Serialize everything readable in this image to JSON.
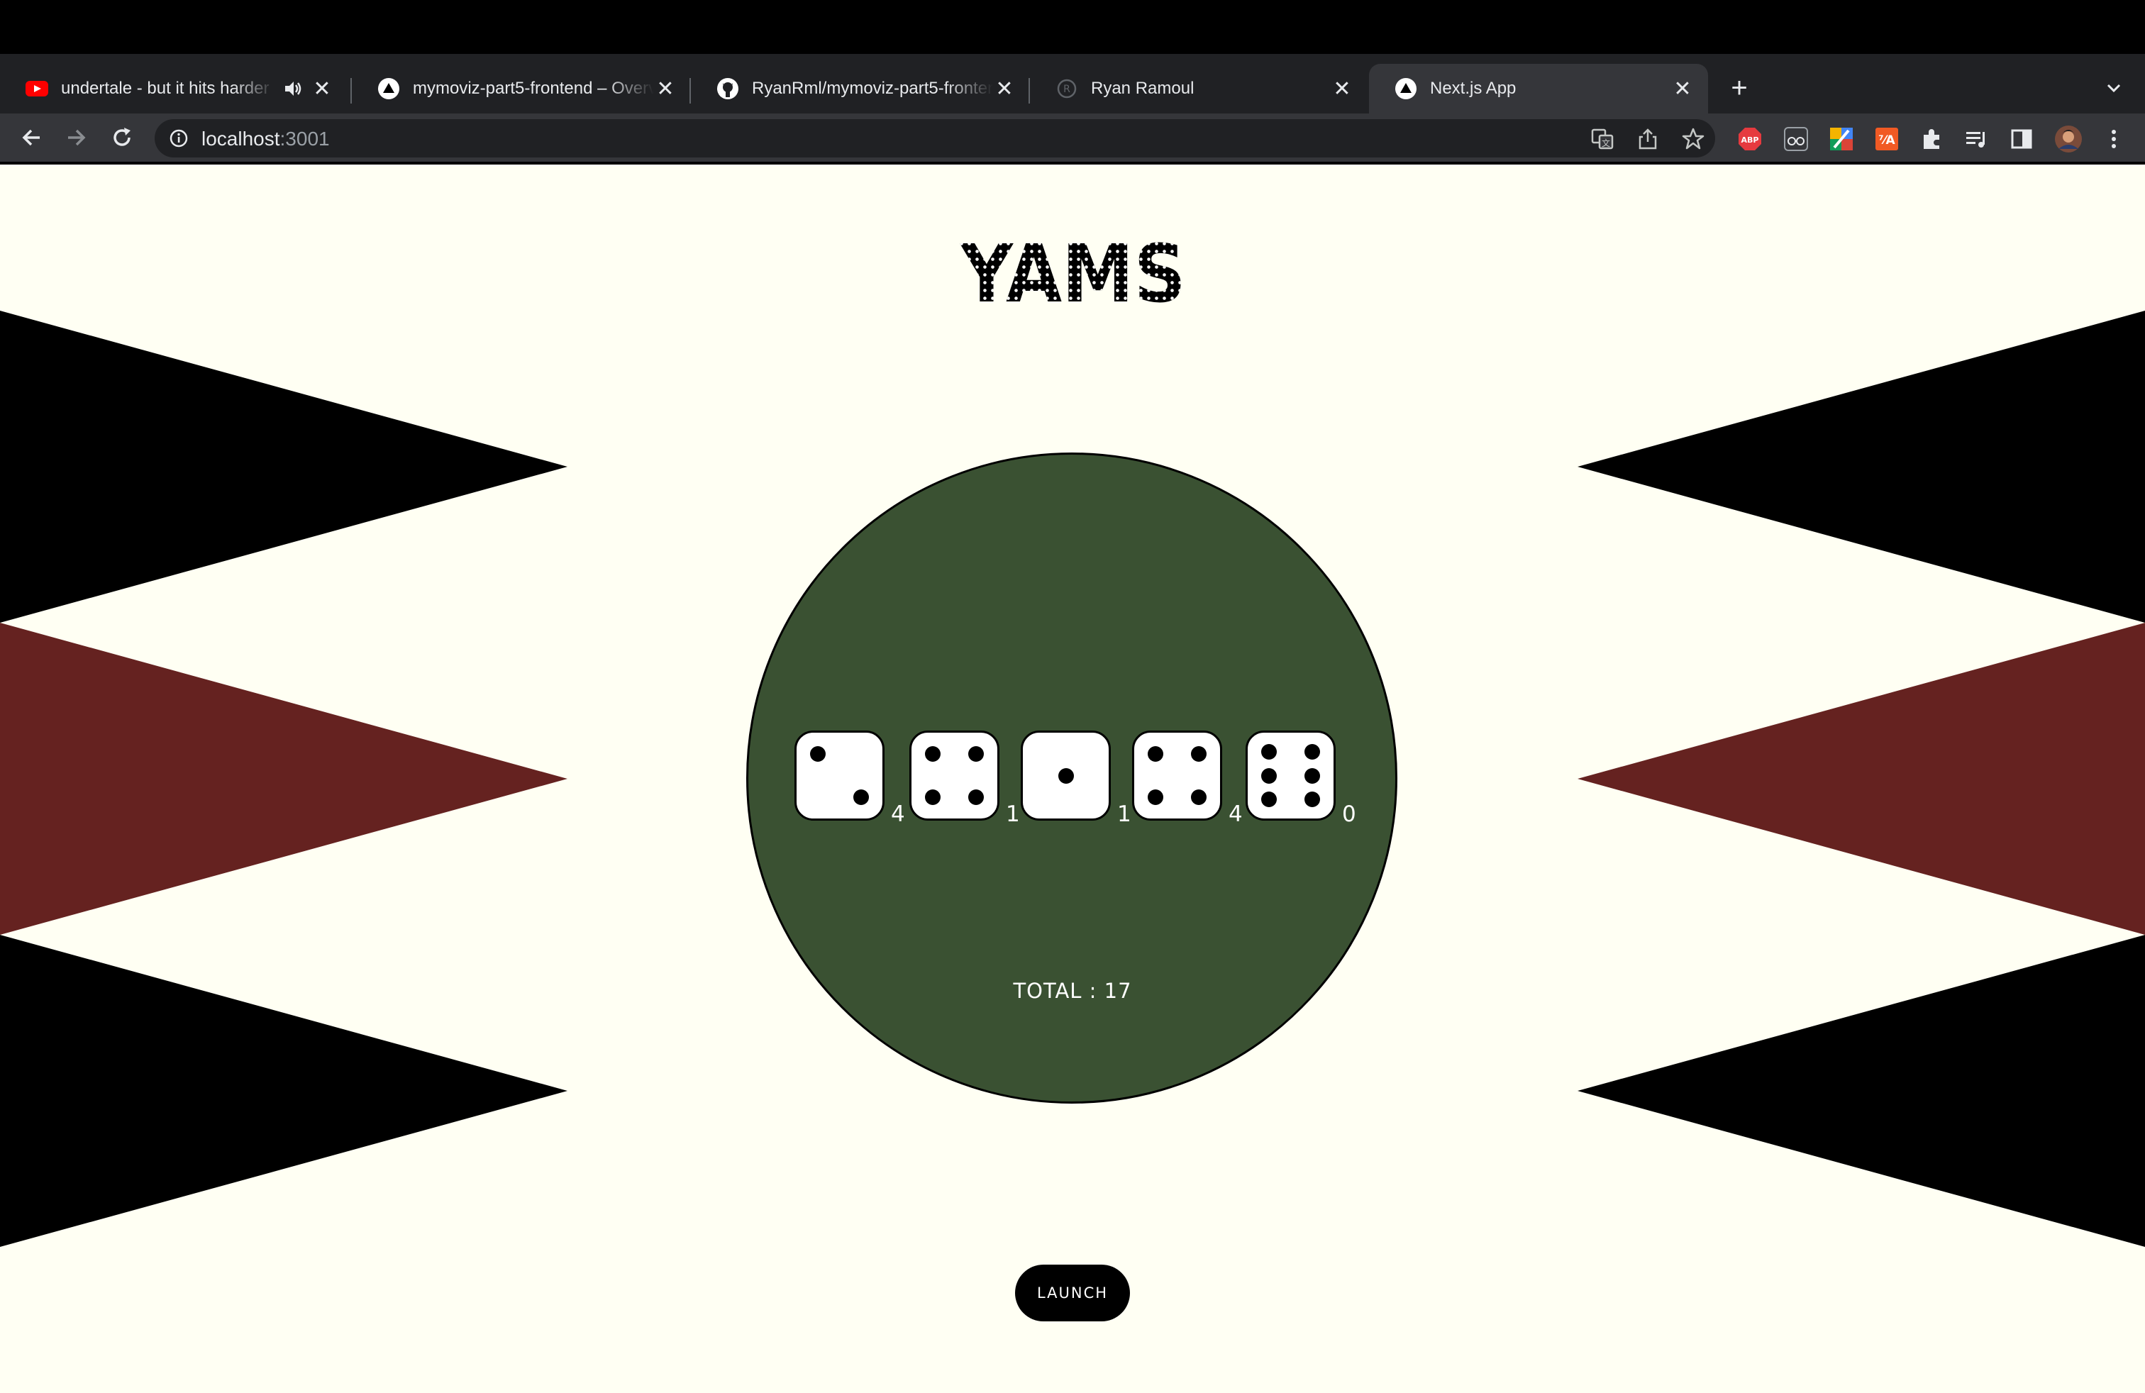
{
  "browser": {
    "tabs": [
      {
        "title": "undertale - but it hits harder",
        "favicon": "youtube-icon",
        "audio": true
      },
      {
        "title": "mymoviz-part5-frontend – Overview",
        "favicon": "vercel-icon"
      },
      {
        "title": "RyanRml/mymoviz-part5-frontend",
        "favicon": "github-icon"
      },
      {
        "title": "Ryan Ramoul",
        "favicon": "registered-icon"
      },
      {
        "title": "Next.js App",
        "favicon": "vercel-icon",
        "active": true
      }
    ],
    "address": {
      "host": "localhost",
      "port": ":3001"
    },
    "extensions": [
      "adblock-plus-icon",
      "reader-glasses-icon",
      "colorful-extension-icon",
      "translate-extension-icon",
      "puzzle-icon",
      "media-queue-icon",
      "side-panel-icon",
      "profile-avatar"
    ]
  },
  "game": {
    "logo_text": "YAMS",
    "dice": [
      {
        "face": 2,
        "count": "4"
      },
      {
        "face": 4,
        "count": "1"
      },
      {
        "face": 1,
        "count": "1"
      },
      {
        "face": 4,
        "count": "4"
      },
      {
        "face": 6,
        "count": "0"
      }
    ],
    "total_text": "TOTAL : 17",
    "launch_label": "LAUNCH"
  },
  "colors": {
    "page_background": "#fffff3",
    "table_felt": "#3a5132",
    "stripe_dark": "#000000",
    "stripe_red": "#652220"
  }
}
